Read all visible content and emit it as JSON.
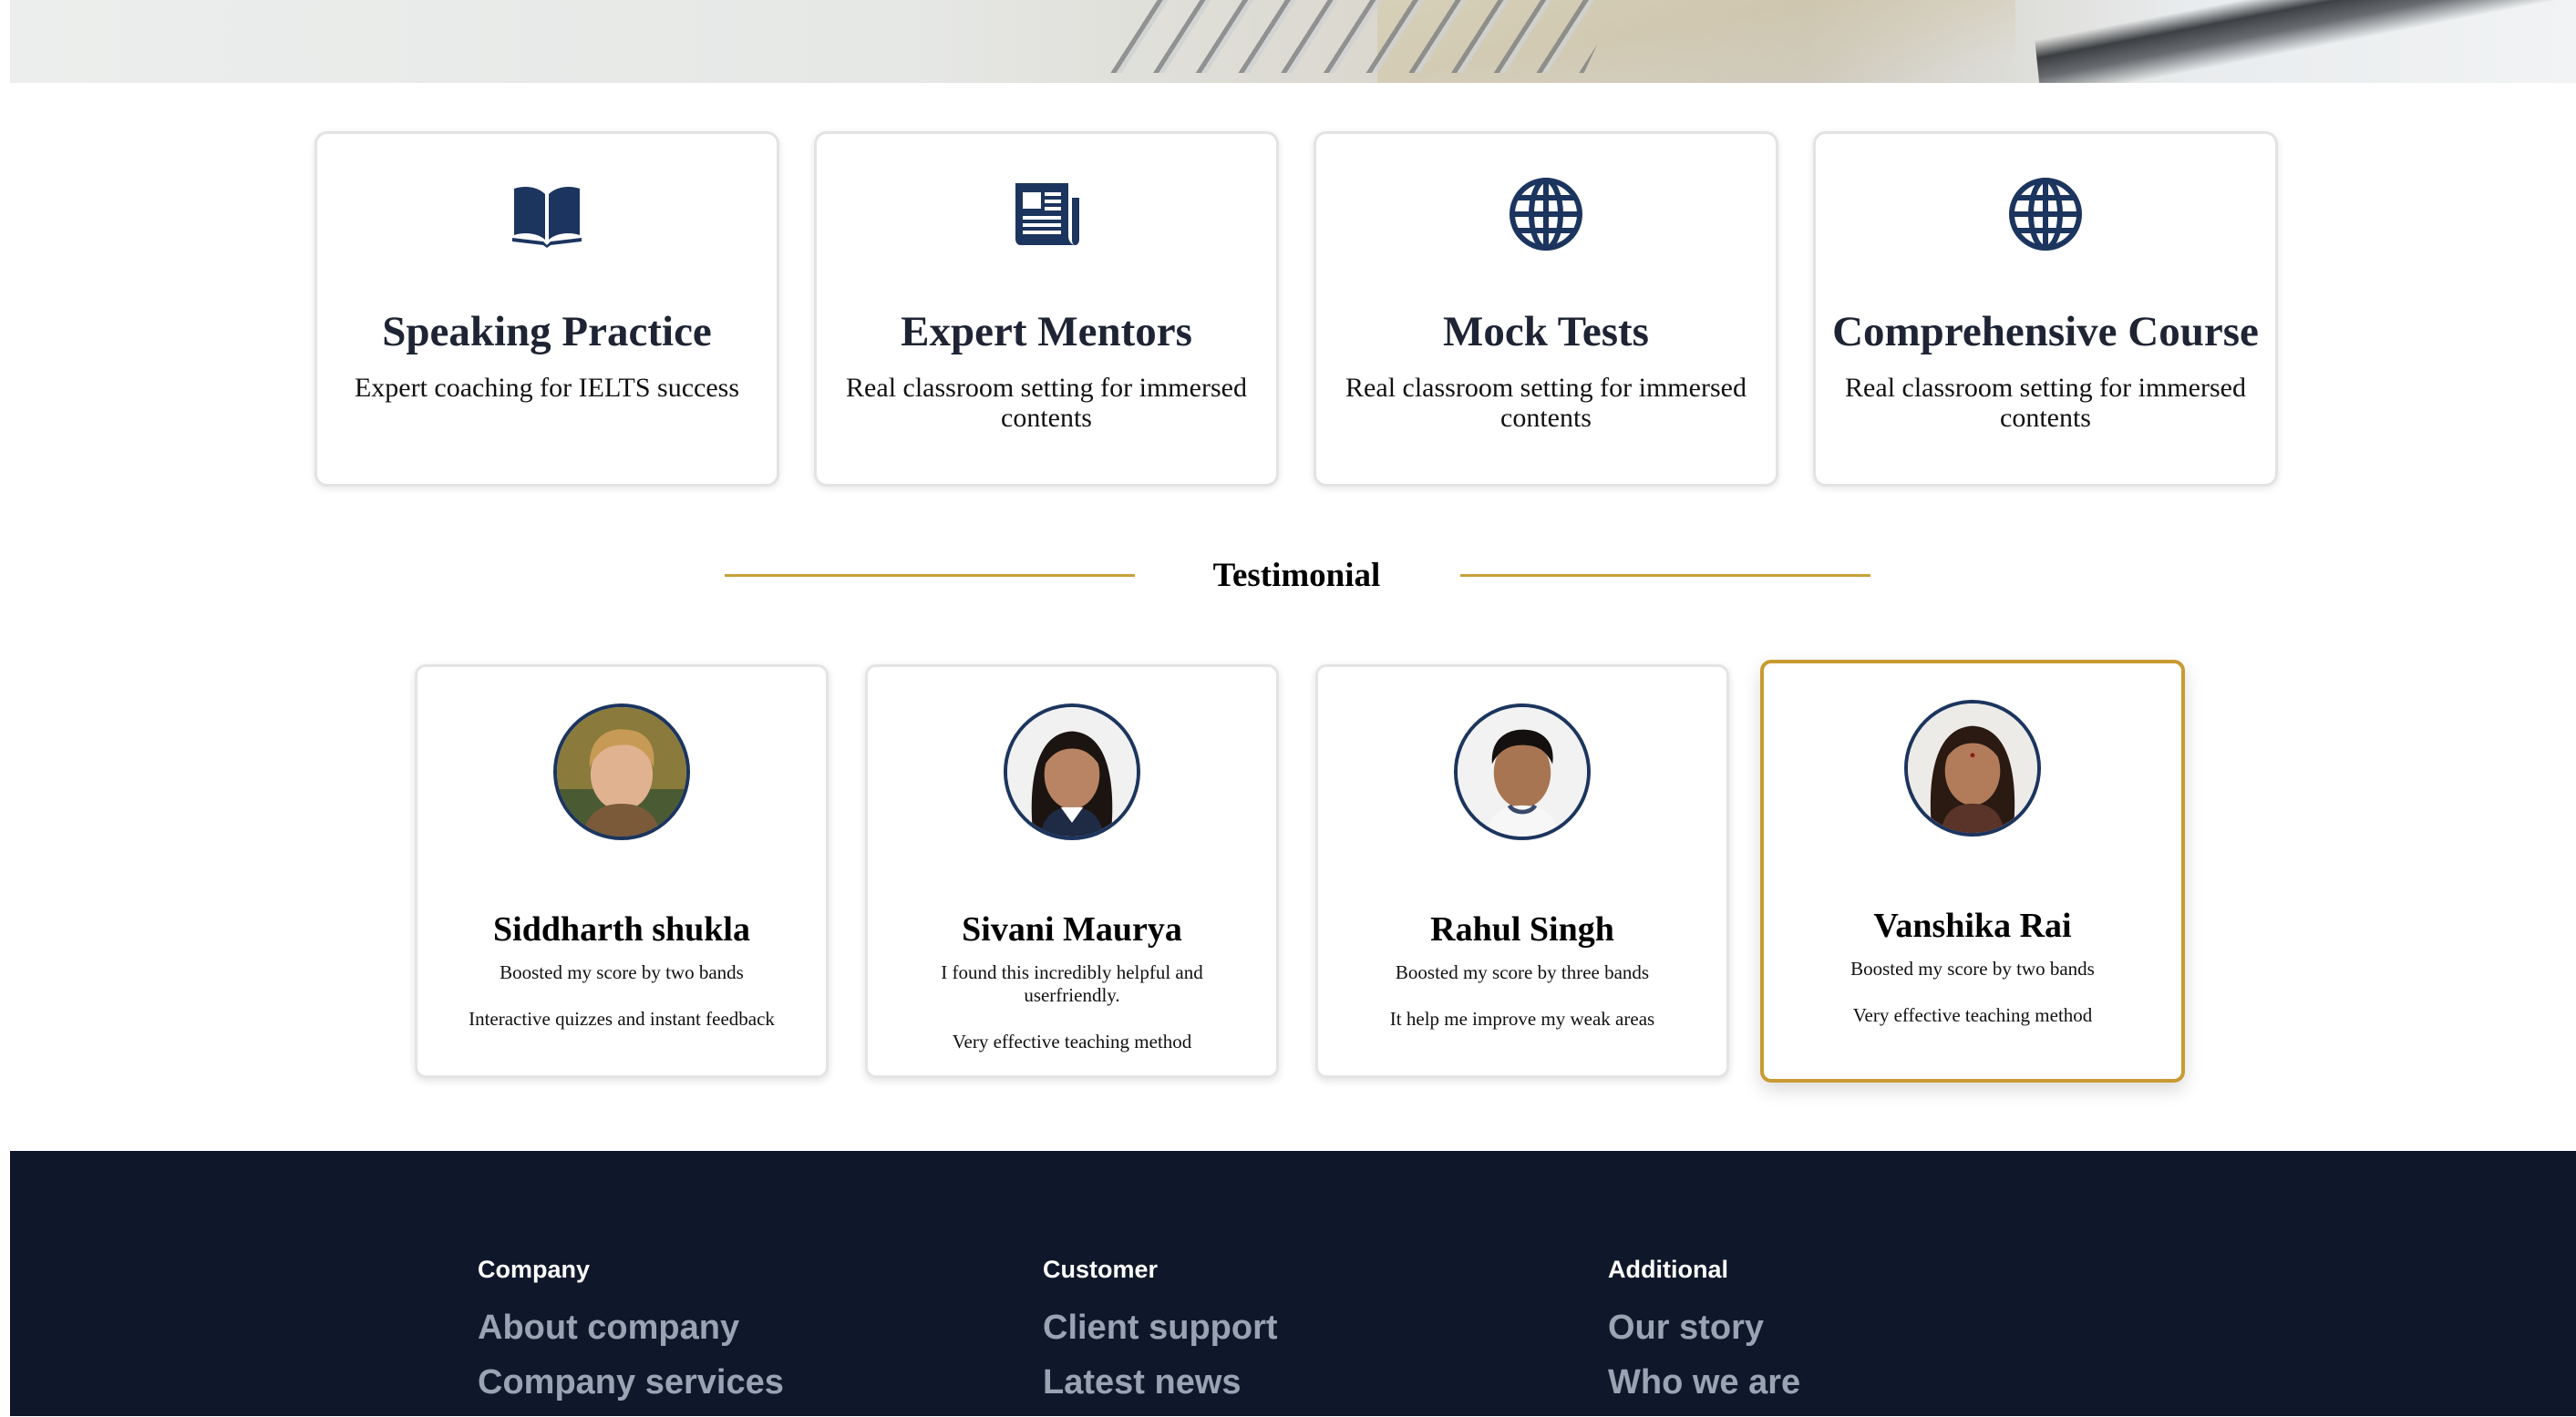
{
  "features": [
    {
      "icon": "open-book-icon",
      "title": "Speaking Practice",
      "desc": "Expert coaching for IELTS success"
    },
    {
      "icon": "newspaper-icon",
      "title": "Expert Mentors",
      "desc": "Real classroom setting for immersed contents"
    },
    {
      "icon": "globe-icon",
      "title": "Mock Tests",
      "desc": "Real classroom setting for immersed contents"
    },
    {
      "icon": "globe-icon",
      "title": "Comprehensive Course",
      "desc": "Real classroom setting for immersed contents"
    }
  ],
  "testimonial": {
    "heading": "Testimonial",
    "items": [
      {
        "name": "Siddharth shukla",
        "quote": "Boosted my score by two bands",
        "note": "Interactive quizzes and instant feedback"
      },
      {
        "name": "Sivani Maurya",
        "quote": "I found this incredibly helpful and userfriendly.",
        "note": "Very effective teaching method"
      },
      {
        "name": "Rahul Singh",
        "quote": "Boosted my score by three bands",
        "note": "It help me improve my weak areas"
      },
      {
        "name": "Vanshika Rai",
        "quote": "Boosted my score by two bands",
        "note": "Very effective teaching method"
      }
    ]
  },
  "footer": {
    "columns": [
      {
        "heading": "Company",
        "links": [
          "About company",
          "Company services"
        ]
      },
      {
        "heading": "Customer",
        "links": [
          "Client support",
          "Latest news"
        ]
      },
      {
        "heading": "Additional",
        "links": [
          "Our story",
          "Who we are"
        ]
      }
    ]
  },
  "colors": {
    "accent": "#c8a03a",
    "icon": "#1c355e",
    "footer_bg": "#0f172a",
    "footer_link": "#9aa3b2"
  }
}
